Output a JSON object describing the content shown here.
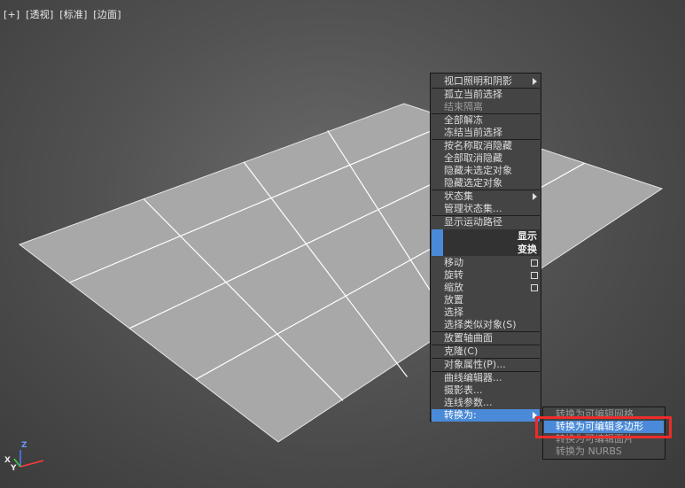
{
  "viewport": {
    "label_parts": [
      "[+]",
      "[透视]",
      "[标准]",
      "[边面]"
    ],
    "axes": {
      "z": "Z",
      "x": "X",
      "y": "Y"
    }
  },
  "quad_menu": {
    "items": [
      {
        "label": "视口照明和阴影",
        "submenu": true
      },
      {
        "label": "孤立当前选择"
      },
      {
        "label": "结束隔离",
        "disabled": true
      },
      {
        "label": "全部解冻"
      },
      {
        "label": "冻结当前选择"
      },
      {
        "label": "按名称取消隐藏"
      },
      {
        "label": "全部取消隐藏"
      },
      {
        "label": "隐藏未选定对象"
      },
      {
        "label": "隐藏选定对象"
      },
      {
        "label": "状态集",
        "submenu": true
      },
      {
        "label": "管理状态集..."
      },
      {
        "label": "显示运动路径"
      },
      {
        "label": "移动",
        "options": true
      },
      {
        "label": "旋转",
        "options": true
      },
      {
        "label": "缩放",
        "options": true
      },
      {
        "label": "放置"
      },
      {
        "label": "选择"
      },
      {
        "label": "选择类似对象(S)"
      },
      {
        "label": "放置轴曲面"
      },
      {
        "label": "克隆(C)"
      },
      {
        "label": "对象属性(P)..."
      },
      {
        "label": "曲线编辑器..."
      },
      {
        "label": "摄影表..."
      },
      {
        "label": "连线参数..."
      },
      {
        "label": "转换为:",
        "submenu": true,
        "highlighted": true
      }
    ],
    "section_headers": [
      "显示",
      "变换"
    ]
  },
  "convert_submenu": {
    "items": [
      {
        "label": "转换为可编辑网格"
      },
      {
        "label": "转换为可编辑多边形",
        "highlighted": true
      },
      {
        "label": "转换为可编辑面片"
      },
      {
        "label": "转换为 NURBS"
      }
    ]
  },
  "colors": {
    "highlight": "#4a8ad8",
    "menu_bg": "#444444",
    "callout": "#ee2b2b",
    "plane_fill": "#a8a8a8",
    "grid_line": "#ffffff"
  }
}
